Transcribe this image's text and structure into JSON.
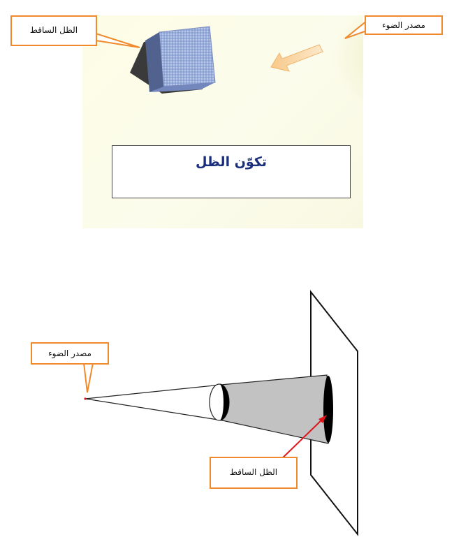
{
  "title": "تكوّن الظل",
  "top_figure": {
    "callout_shadow": "الظل الساقط",
    "callout_light": "مصدر الضوء"
  },
  "bottom_figure": {
    "callout_light": "مصدر الضوء",
    "callout_shadow": "الظل الساقط"
  },
  "colors": {
    "callout_border": "#f08a2c",
    "title_text": "#1a2e7d",
    "arrow_red": "#e0141b",
    "cube_face": "#8ea3d6",
    "cone_fill": "#c0c0c0"
  }
}
